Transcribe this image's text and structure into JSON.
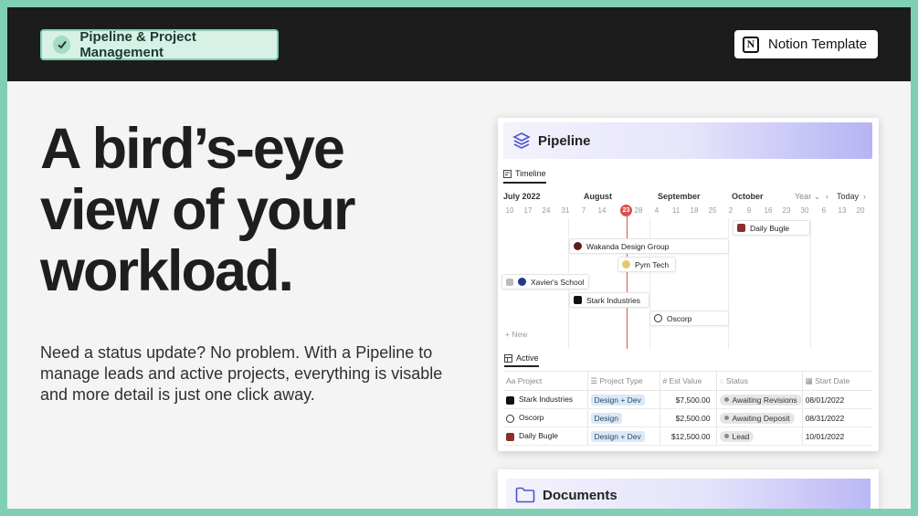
{
  "header": {
    "badge_label": "Pipeline & Project Management",
    "badge_icon": "check-circle-icon",
    "notion_label": "Notion Template",
    "notion_icon": "notion-logo-icon",
    "accent_color": "#7fcfb2"
  },
  "hero": {
    "headline_lines": [
      "A bird’s-eye",
      "view of your",
      "workload."
    ],
    "description": "Need a status update? No problem. With a Pipeline to manage leads and active projects, everything is visable and more detail is just one click away."
  },
  "pipeline": {
    "title": "Pipeline",
    "icon": "stack-layers-icon",
    "timeline_tab": "Timeline",
    "months": [
      "July 2022",
      "August",
      "September",
      "October"
    ],
    "days": [
      "10",
      "17",
      "24",
      "31",
      "7",
      "14",
      "23",
      "28",
      "4",
      "11",
      "18",
      "25",
      "2",
      "9",
      "16",
      "23",
      "30",
      "6",
      "13",
      "20"
    ],
    "today_day": "23",
    "controls": {
      "view": "Year",
      "today": "Today"
    },
    "items": [
      {
        "label": "Daily Bugle",
        "icon_color": "#8b2e2e"
      },
      {
        "label": "Wakanda Design Group",
        "icon_color": "#5b1e1e"
      },
      {
        "label": "Pym Tech",
        "icon_color": "#b8860b"
      },
      {
        "label": "Xavier's School",
        "icon_color": "#1f3a8a"
      },
      {
        "label": "Stark Industries",
        "icon_color": "#111111"
      },
      {
        "label": "Oscorp",
        "icon_color": "#333333"
      }
    ],
    "new_label": "New",
    "active_tab": "Active",
    "columns": [
      "Project",
      "Project Type",
      "Est Value",
      "Status",
      "Start Date"
    ],
    "column_icons": [
      "text-icon",
      "list-icon",
      "hash-icon",
      "status-icon",
      "calendar-icon"
    ],
    "rows": [
      {
        "project": "Stark Industries",
        "type": "Design + Dev",
        "value": "$7,500.00",
        "status": "Awaiting Revisions",
        "date": "08/01/2022"
      },
      {
        "project": "Oscorp",
        "type": "Design",
        "value": "$2,500.00",
        "status": "Awaiting Deposit",
        "date": "08/31/2022"
      },
      {
        "project": "Daily Bugle",
        "type": "Design + Dev",
        "value": "$12,500.00",
        "status": "Lead",
        "date": "10/01/2022"
      }
    ]
  },
  "documents": {
    "title": "Documents",
    "icon": "folder-icon"
  }
}
